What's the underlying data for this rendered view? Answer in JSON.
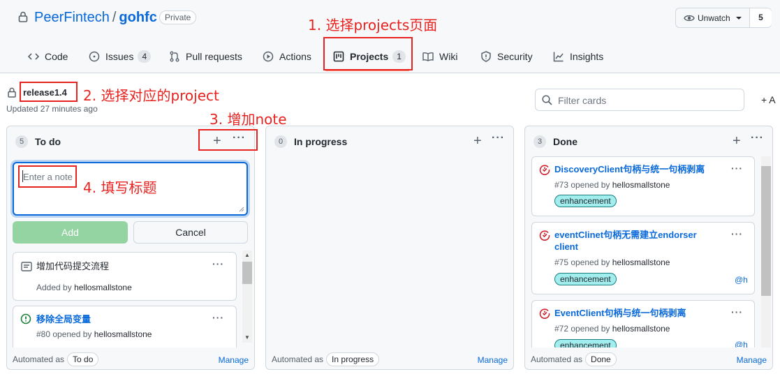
{
  "repo": {
    "owner": "PeerFintech",
    "separator": "/",
    "name": "gohfc",
    "visibility": "Private"
  },
  "watch": {
    "label": "Unwatch",
    "count": "5"
  },
  "tabs": [
    {
      "label": "Code"
    },
    {
      "label": "Issues",
      "count": "4"
    },
    {
      "label": "Pull requests"
    },
    {
      "label": "Actions"
    },
    {
      "label": "Projects",
      "count": "1"
    },
    {
      "label": "Wiki"
    },
    {
      "label": "Security"
    },
    {
      "label": "Insights"
    }
  ],
  "project": {
    "name": "release1.4",
    "updated": "Updated 27 minutes ago"
  },
  "filter": {
    "placeholder": "Filter cards"
  },
  "add_column": "+ A",
  "columns": [
    {
      "count": "5",
      "title": "To do",
      "automated_label": "Automated as",
      "automated_value": "To do",
      "manage": "Manage",
      "note": {
        "placeholder": "Enter a note",
        "add": "Add",
        "cancel": "Cancel"
      },
      "cards": [
        {
          "type": "note",
          "title": "增加代码提交流程",
          "meta_prefix": "Added by",
          "user": "hellosmallstone"
        },
        {
          "type": "issue",
          "title": "移除全局变量",
          "meta_prefix": "#80 opened by",
          "user": "hellosmallstone"
        }
      ]
    },
    {
      "count": "0",
      "title": "In progress",
      "automated_label": "Automated as",
      "automated_value": "In progress",
      "manage": "Manage",
      "cards": []
    },
    {
      "count": "3",
      "title": "Done",
      "automated_label": "Automated as",
      "automated_value": "Done",
      "manage": "Manage",
      "cards": [
        {
          "type": "issue",
          "title": "DiscoveryClient句柄与统一句柄剥离",
          "meta_prefix": "#73 opened by",
          "user": "hellosmallstone",
          "label": "enhancement"
        },
        {
          "type": "issue",
          "title": "eventClinet句柄无需建立endorser client",
          "meta_prefix": "#75 opened by",
          "user": "hellosmallstone",
          "label": "enhancement",
          "assignee": "@h"
        },
        {
          "type": "issue",
          "title": "EventClient句柄与统一句柄剥离",
          "meta_prefix": "#72 opened by",
          "user": "hellosmallstone",
          "label": "enhancement",
          "assignee": "@h"
        }
      ]
    }
  ],
  "annotations": {
    "step1": "1. 选择projects页面",
    "step2": "2. 选择对应的project",
    "step3": "3. 增加note",
    "step4": "4. 填写标题"
  },
  "colors": {
    "link": "#0969da",
    "annotation": "#e8231f",
    "issue_open": "#1a7f37",
    "issue_closed": "#cf222e",
    "label_bg": "#a2eeef",
    "add_btn": "#94d3a2"
  }
}
